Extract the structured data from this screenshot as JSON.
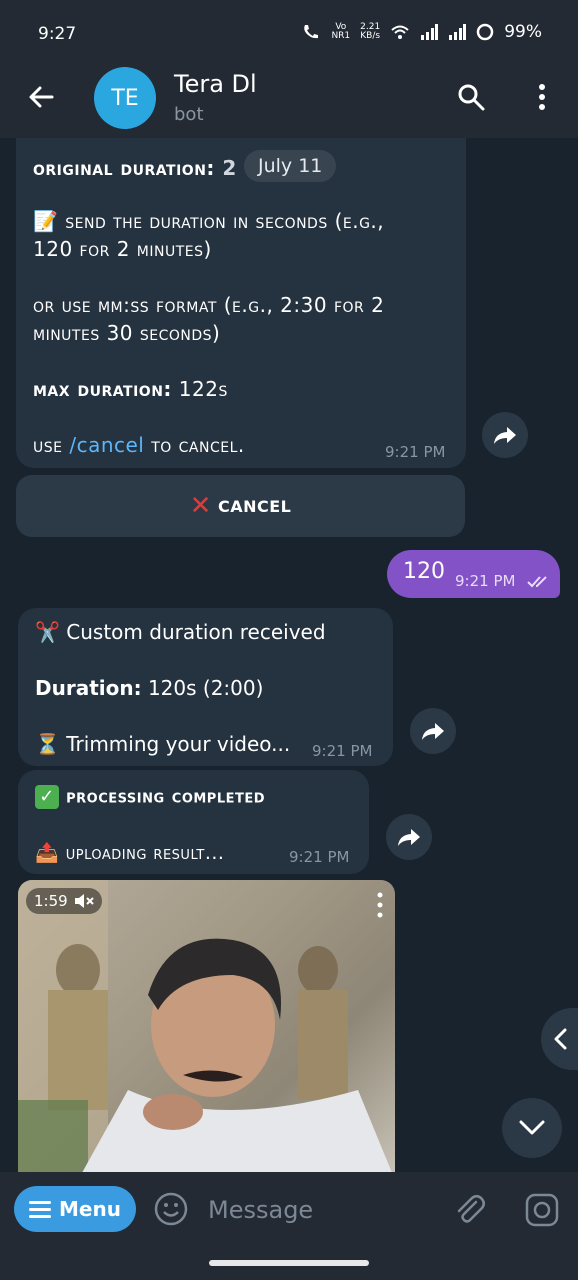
{
  "status_bar": {
    "time": "9:27",
    "net_top": "Vo",
    "net_bottom": "NR1",
    "speed_top": "2.21",
    "speed_bottom": "KB/s",
    "battery": "99%"
  },
  "header": {
    "avatar_initials": "TE",
    "title": "Tera Dl",
    "subtitle": "bot"
  },
  "messages": {
    "m1": {
      "line1_label": "Original Duration:",
      "line1_value": " 2",
      "date_chip": "July 11",
      "line2": "Send the duration in seconds (e.g.,",
      "line3": "120 for 2 minutes)",
      "line4": "Or use MM:SS format (e.g., 2:30 for 2",
      "line5": "minutes 30 seconds)",
      "line6_label": "Max Duration:",
      "line6_value": " 122s",
      "line7_pre": "Use ",
      "line7_link": "/cancel",
      "line7_post": " to cancel.",
      "time": "9:21 PM"
    },
    "cancel_button": "CANCEL",
    "m2": {
      "text": "120",
      "time": "9:21 PM"
    },
    "m3": {
      "title": "Custom duration received",
      "duration_label": "Duration:",
      "duration_value": " 120s (2:00)",
      "status": "Trimming your video...",
      "time": "9:21 PM"
    },
    "m4": {
      "line1": "Processing Completed",
      "line2": "Uploading result...",
      "time": "9:21 PM"
    },
    "video": {
      "duration": "1:59"
    }
  },
  "composer": {
    "menu_label": "Menu",
    "placeholder": "Message"
  },
  "colors": {
    "accent": "#3a9be0",
    "outgoing_bubble": "#8352c7",
    "incoming_bubble": "#25323f",
    "link": "#5eb5f7"
  },
  "icons": [
    "back-arrow-icon",
    "search-icon",
    "more-vertical-icon",
    "memo-icon",
    "cross-mark-icon",
    "scissors-icon",
    "hourglass-icon",
    "check-mark-icon",
    "outbox-tray-icon",
    "share-icon",
    "mute-icon",
    "chevron-left-icon",
    "chevron-down-icon",
    "hamburger-icon",
    "emoji-icon",
    "paperclip-icon",
    "camera-icon"
  ]
}
